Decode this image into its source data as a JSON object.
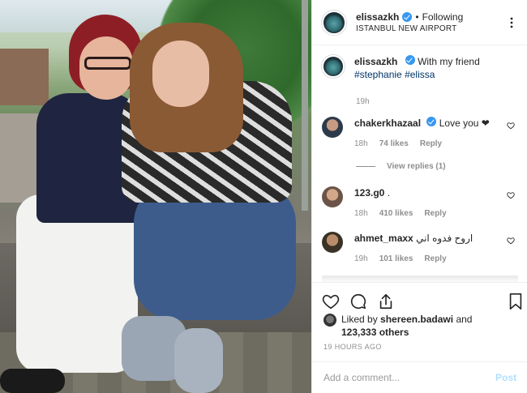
{
  "post": {
    "username": "elissazkh",
    "following": "Following",
    "location": "ISTANBUL NEW AIRPORT",
    "caption_text": "With my friend",
    "hashtags": [
      "#stephanie",
      "#elissa"
    ],
    "caption_time": "19h"
  },
  "comments": [
    {
      "username": "chakerkhazaal",
      "verified": true,
      "text": "Love you ❤",
      "time": "18h",
      "likes": "74 likes",
      "reply": "Reply",
      "avatar_color": "#2d3a4a"
    },
    {
      "username": "123.g0",
      "verified": false,
      "text": ".",
      "time": "18h",
      "likes": "410 likes",
      "reply": "Reply",
      "avatar_color": "#6b5447"
    },
    {
      "username": "ahmet_maxx",
      "verified": false,
      "text": "اروح فدوه اني",
      "time": "19h",
      "likes": "101 likes",
      "reply": "Reply",
      "avatar_color": "#3a3226"
    }
  ],
  "view_replies": "View replies (1)",
  "liked_by": {
    "prefix": "Liked by",
    "user": "shereen.badawi",
    "and": "and",
    "count": "123,333 others"
  },
  "timestamp": "19 HOURS AGO",
  "add_comment": {
    "placeholder": "Add a comment...",
    "post_label": "Post"
  },
  "colors": {
    "link": "#003569",
    "verified": "#3897f0",
    "post_button": "#b2dffc"
  },
  "icons": [
    "more-options-icon",
    "verified-icon",
    "heart-icon",
    "comment-icon",
    "share-icon",
    "bookmark-icon"
  ]
}
